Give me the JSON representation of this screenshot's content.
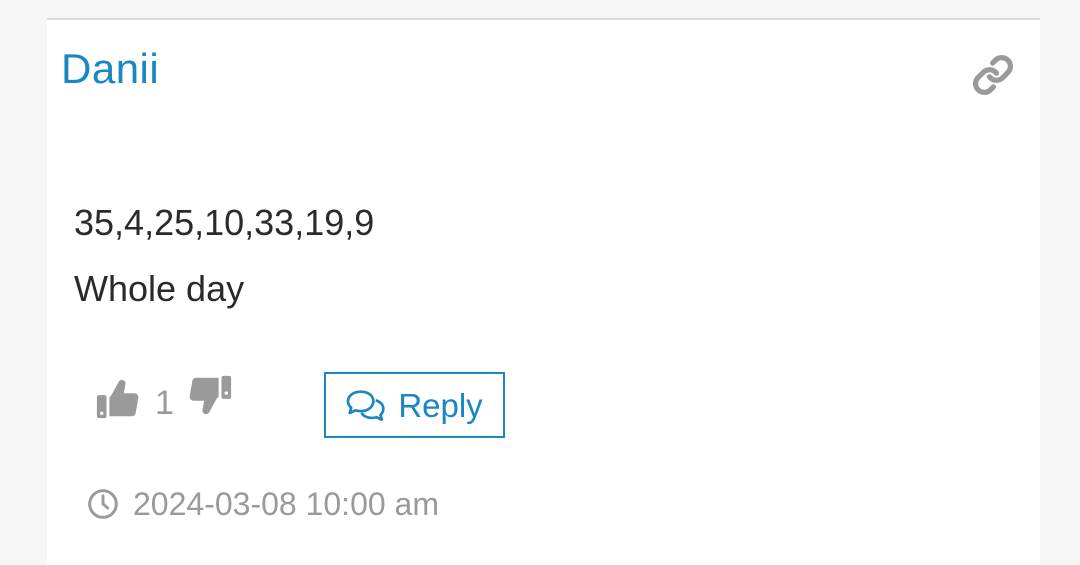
{
  "comment": {
    "author": "Danii",
    "body_lines": [
      "35,4,25,10,33,19,9",
      "Whole day"
    ],
    "votes": {
      "up_count": "1",
      "up_icon": "thumbs-up-icon",
      "down_icon": "thumbs-down-icon"
    },
    "reply_label": "Reply",
    "reply_icon": "comments-icon",
    "permalink_icon": "link-icon",
    "timestamp": "2024-03-08 10:00 am",
    "timestamp_icon": "clock-icon"
  },
  "colors": {
    "accent": "#1a86c2",
    "text": "#2a2a2a",
    "muted": "#9a9a9a",
    "background": "#f6f6f6",
    "card": "#ffffff"
  }
}
